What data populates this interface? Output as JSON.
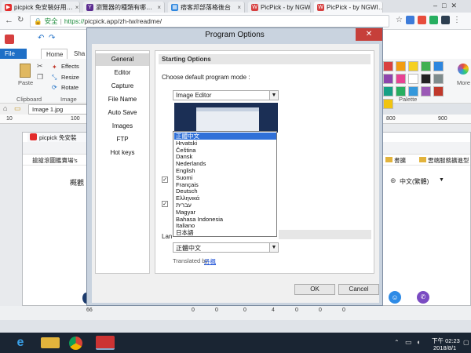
{
  "browser": {
    "tabs": [
      {
        "label": "picpick 免安裝好用…",
        "color": "#e32b2b",
        "glyph": "▶"
      },
      {
        "label": "瀏覽器的種類有哪…",
        "color": "#5c2d91",
        "glyph": "Y"
      },
      {
        "label": "痞客邦部落格後台",
        "color": "#2e86de",
        "glyph": "▦"
      },
      {
        "label": "PicPick - by NGWI…",
        "color": "#d63f3f",
        "glyph": "W"
      },
      {
        "label": "PicPick - by NGWI…",
        "color": "#d63f3f",
        "glyph": "W"
      }
    ],
    "tab_close": "×",
    "security_label": "安全",
    "url_scheme": "https://",
    "url_rest": "picpick.app/zh-tw/readme/"
  },
  "picpick": {
    "ribbon_tabs": [
      "File",
      "Home",
      "Sha"
    ],
    "clipboard_label": "Clipboard",
    "image_label": "Image",
    "palette_label": "Palette",
    "paste_label": "Paste",
    "effects_label": "Effects",
    "resize_label": "Resize",
    "rotate_label": "Rotate",
    "more_label": "More",
    "doc_tab": "Image 1.jpg",
    "ruler_marks": [
      "10",
      "100",
      "800",
      "900"
    ],
    "palette_colors": [
      "#d94040",
      "#f39c12",
      "#f5d020",
      "#40b050",
      "#2e86de",
      "#8e44ad",
      "#e84393",
      "#ffffff",
      "#222222",
      "#7f8c8d",
      "#16a085",
      "#27ae60",
      "#3498db",
      "#9b59b6",
      "#c0392b",
      "#f1c40f"
    ]
  },
  "inner_page": {
    "tab_label": "picpick 免安裝好…",
    "bookmark_text": "搶搶滾圖鑑賣場's",
    "bookmark_right1": "書擴",
    "bookmark_right2": "雲端服務擴進型",
    "nav_left": "概觀",
    "lang_selector": "中文(繁體)",
    "status_numbers": [
      "66",
      "0",
      "0",
      "0",
      "4",
      "0",
      "0",
      "0"
    ]
  },
  "dialog": {
    "title": "Program Options",
    "close": "✕",
    "nav_items": [
      "General",
      "Editor",
      "Capture",
      "File Name",
      "Auto Save",
      "Images",
      "FTP",
      "Hot keys"
    ],
    "section_title": "Starting Options",
    "mode_label": "Choose default program mode :",
    "mode_value": "Image Editor",
    "languages": [
      "正體中文",
      "Hrvatski",
      "Čeština",
      "Dansk",
      "Nederlands",
      "English",
      "Suomi",
      "Français",
      "Deutsch",
      "Ελληνικά",
      "עברית",
      "Magyar",
      "Bahasa Indonesia",
      "Italiano",
      "日本語"
    ],
    "selected_language": "正體中文",
    "lang_label_partial": "Lan",
    "language_value": "正體中文",
    "translated_by": "Translated by",
    "translator": "丹楓",
    "ok_label": "OK",
    "cancel_label": "Cancel",
    "arrow": "▼"
  },
  "taskbar": {
    "time": "下午 02:23",
    "date": "2018/8/1"
  }
}
